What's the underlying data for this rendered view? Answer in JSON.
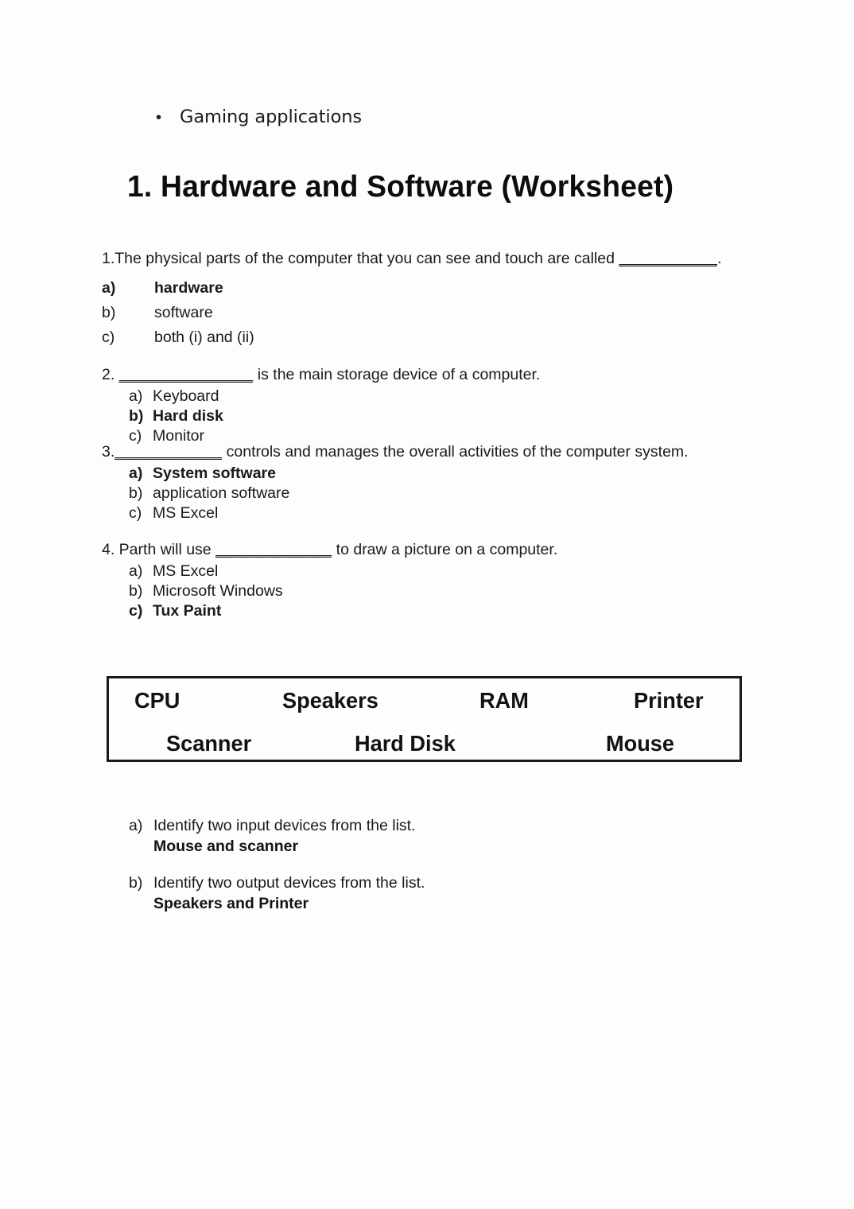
{
  "document": {
    "intro_bullet": {
      "bullet_glyph": "•",
      "text": "Gaming applications"
    },
    "heading": "1. Hardware and Software (Worksheet)",
    "questions": [
      {
        "number": "1.",
        "prompt_before": "1.The physical parts of the computer that you can see and touch are called ",
        "blank": "___________",
        "prompt_after": ".",
        "options": [
          {
            "marker": "a)",
            "text": "hardware",
            "bold": true
          },
          {
            "marker": "b)",
            "text": "software",
            "bold": false
          },
          {
            "marker": "c)",
            "text": "both (i) and (ii)",
            "bold": false
          }
        ]
      },
      {
        "number": "2.",
        "prompt_before": "2. ",
        "blank": "_______________",
        "prompt_after": " is the main storage device of a computer.",
        "options": [
          {
            "marker": "a)",
            "text": "Keyboard",
            "bold": false
          },
          {
            "marker": "b)",
            "text": "Hard disk",
            "bold": true
          },
          {
            "marker": "c)",
            "text": "Monitor",
            "bold": false
          }
        ]
      },
      {
        "number": "3.",
        "prompt_before": "3.",
        "blank": "____________",
        "prompt_after": " controls and manages the overall activities of the computer system.",
        "options": [
          {
            "marker": "a)",
            "text": "System software",
            "bold": true
          },
          {
            "marker": "b)",
            "text": "application software",
            "bold": false
          },
          {
            "marker": "c)",
            "text": "MS Excel",
            "bold": false
          }
        ]
      },
      {
        "number": "4.",
        "prompt_before": "4. Parth will use ",
        "blank": "_____________",
        "prompt_after": " to draw a picture on a computer.",
        "options": [
          {
            "marker": "a)",
            "text": "MS Excel",
            "bold": false
          },
          {
            "marker": "b)",
            "text": "Microsoft Windows",
            "bold": false
          },
          {
            "marker": "c)",
            "text": "Tux Paint",
            "bold": true
          }
        ]
      }
    ],
    "word_bank": {
      "row1": [
        "CPU",
        "Speakers",
        "RAM",
        "Printer"
      ],
      "row2": [
        "Scanner",
        "Hard Disk",
        "Mouse"
      ]
    },
    "identify_questions": [
      {
        "marker": "a)",
        "question": "Identify two input devices from the list.",
        "answer": "Mouse and scanner"
      },
      {
        "marker": "b)",
        "question": "Identify two output devices from the list.",
        "answer": "Speakers and Printer"
      }
    ]
  }
}
